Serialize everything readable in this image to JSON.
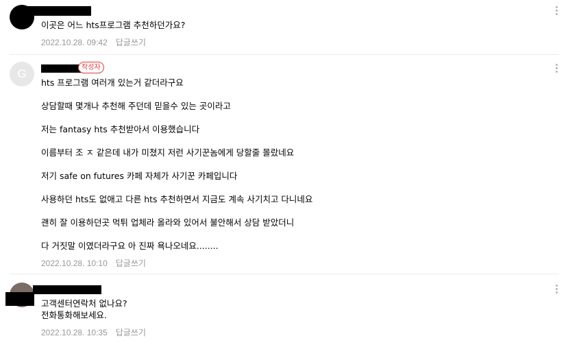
{
  "comments": [
    {
      "avatar": "profile-photo",
      "lines": [
        "이곳은 어느 hts프로그램 추천하던가요?"
      ],
      "date": "2022.10.28. 09:42",
      "reply_label": "답글쓰기",
      "menu_icon": "more-vertical-icon"
    },
    {
      "avatar": "G",
      "author_badge": "작성자",
      "lines": [
        "hts 프로그램 여러개 있는거 같더라구요",
        "상담할때 몇개나 추천해 주던데 믿을수 있는 곳이라고",
        "저는 fantasy hts 추천받아서 이용했습니다",
        "이름부터 조 ㅈ 같은데 내가 미쳤지 저런 사기꾼놈에게 당할줄 몰랐네요",
        "저기 safe on futures 카페 자체가 사기꾼 카페입니다",
        "사용하던 hts도 없애고 다른 hts 추천하면서 지금도 계속 사기치고 다니네요",
        "괜히 잘 이용하던곳 먹튀 업체라 올라와 있어서 불안해서 상담 받았더니",
        "다 거짓말 이였더라구요 아 진짜 욕나오네요........"
      ],
      "date": "2022.10.28. 10:10",
      "reply_label": "답글쓰기",
      "menu_icon": "more-vertical-icon"
    },
    {
      "avatar": "profile-photo",
      "lines": [
        "고객센터연락처 없나요?",
        "전화통화해보세요."
      ],
      "date": "2022.10.28. 10:35",
      "reply_label": "답글쓰기",
      "menu_icon": "more-vertical-icon"
    }
  ],
  "colors": {
    "meta_text": "#979797",
    "author_badge": "#e5383b",
    "divider": "#ebebeb"
  }
}
